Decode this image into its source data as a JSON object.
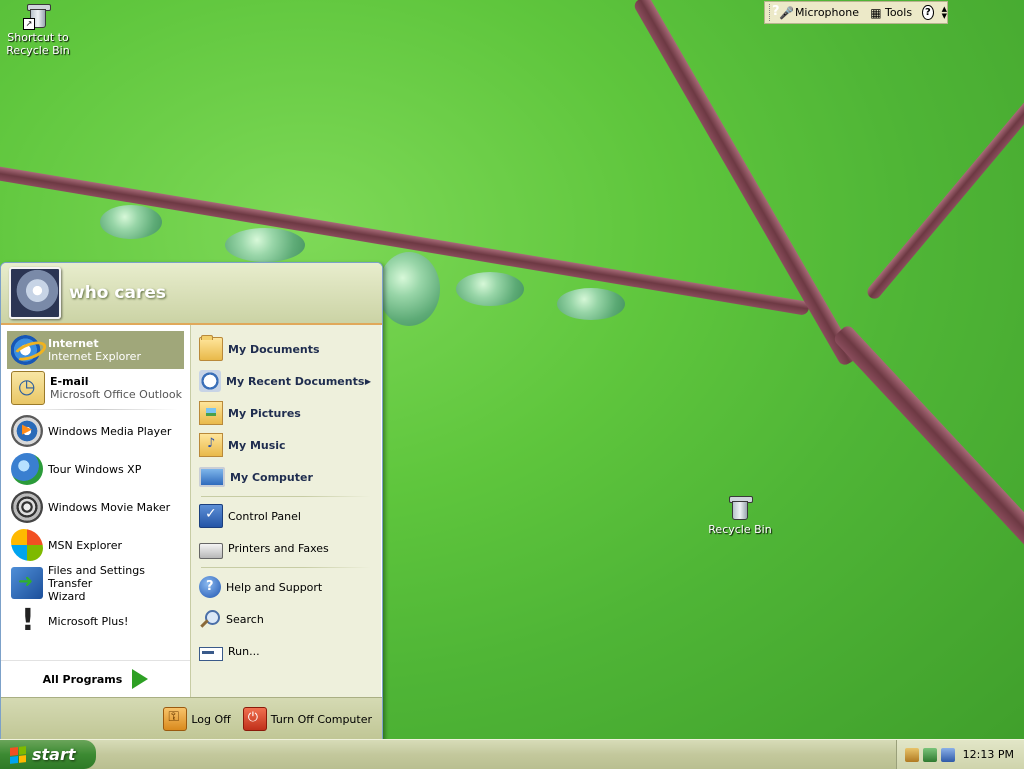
{
  "desktop": {
    "icons": [
      {
        "label_line1": "Shortcut to",
        "label_line2": "Recycle Bin"
      },
      {
        "label_line1": "Recycle Bin",
        "label_line2": ""
      }
    ]
  },
  "langbar": {
    "microphone_label": "Microphone",
    "tools_label": "Tools",
    "help_label": "?"
  },
  "startmenu": {
    "username": "who cares",
    "pinned": [
      {
        "title": "Internet",
        "subtitle": "Internet Explorer",
        "icon": "internet-explorer-icon"
      },
      {
        "title": "E-mail",
        "subtitle": "Microsoft Office Outlook",
        "icon": "outlook-icon"
      }
    ],
    "recent": [
      {
        "label": "Windows Media Player",
        "icon": "media-player-icon"
      },
      {
        "label": "Tour Windows XP",
        "icon": "tour-icon"
      },
      {
        "label": "Windows Movie Maker",
        "icon": "movie-maker-icon"
      },
      {
        "label": "MSN Explorer",
        "icon": "msn-icon"
      },
      {
        "label_line1": "Files and Settings Transfer",
        "label_line2": "Wizard",
        "icon": "transfer-wizard-icon"
      },
      {
        "label": "Microsoft Plus!",
        "icon": "plus-icon"
      }
    ],
    "all_programs": "All Programs",
    "places": [
      {
        "label": "My Documents",
        "icon": "folder-icon"
      },
      {
        "label": "My Recent Documents",
        "icon": "recent-documents-icon"
      },
      {
        "label": "My Pictures",
        "icon": "pictures-icon"
      },
      {
        "label": "My Music",
        "icon": "music-icon"
      },
      {
        "label": "My Computer",
        "icon": "computer-icon"
      }
    ],
    "system": [
      {
        "label": "Control Panel",
        "icon": "control-panel-icon"
      },
      {
        "label": "Printers and Faxes",
        "icon": "printer-icon"
      }
    ],
    "tools": [
      {
        "label": "Help and Support",
        "icon": "help-icon"
      },
      {
        "label": "Search",
        "icon": "search-icon"
      },
      {
        "label": "Run...",
        "icon": "run-icon"
      }
    ],
    "log_off": "Log Off",
    "turn_off": "Turn Off Computer"
  },
  "taskbar": {
    "start_label": "start",
    "clock": "12:13 PM"
  }
}
